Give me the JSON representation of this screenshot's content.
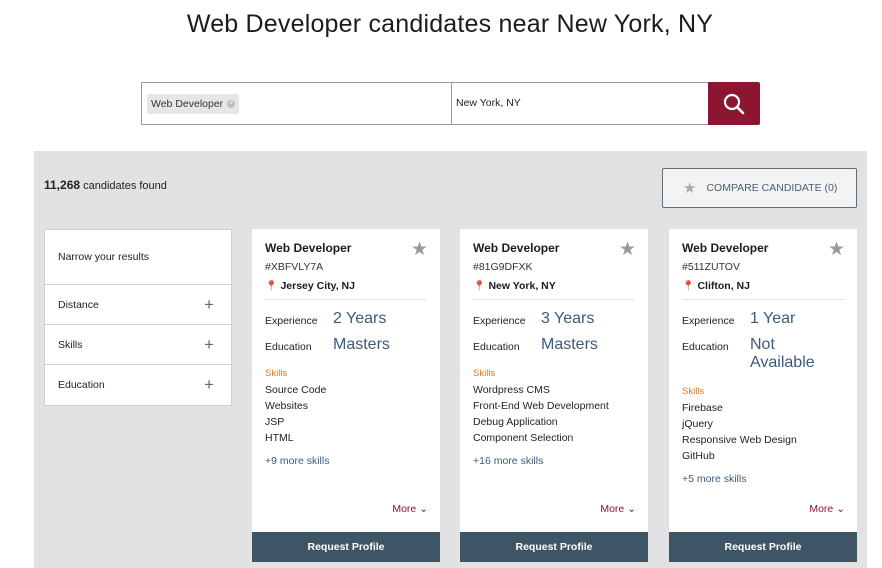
{
  "page": {
    "title": "Web Developer candidates near New York, NY"
  },
  "search": {
    "keyword_chip": "Web Developer",
    "location": "New York, NY"
  },
  "results": {
    "count": "11,268",
    "count_suffix": "candidates found",
    "compare_label": "COMPARE CANDIDATE (0)"
  },
  "filters": {
    "header": "Narrow your results",
    "items": [
      "Distance",
      "Skills",
      "Education"
    ]
  },
  "labels": {
    "experience": "Experience",
    "education": "Education",
    "skills": "Skills",
    "more": "More",
    "request": "Request Profile"
  },
  "cards": [
    {
      "title": "Web Developer",
      "id": "#XBFVLY7A",
      "location": "Jersey City, NJ",
      "experience": "2 Years",
      "education": "Masters",
      "skills": [
        "Source Code",
        "Websites",
        "JSP",
        "HTML"
      ],
      "more_skills": "+9 more skills"
    },
    {
      "title": "Web Developer",
      "id": "#81G9DFXK",
      "location": "New York, NY",
      "experience": "3 Years",
      "education": "Masters",
      "skills": [
        "Wordpress CMS",
        "Front-End Web Development",
        "Debug Application",
        "Component Selection"
      ],
      "more_skills": "+16 more skills"
    },
    {
      "title": "Web Developer",
      "id": "#511ZUTOV",
      "location": "Clifton, NJ",
      "experience": "1 Year",
      "education": "Not Available",
      "skills": [
        "Firebase",
        "jQuery",
        "Responsive Web Design",
        "GitHub"
      ],
      "more_skills": "+5 more skills"
    }
  ],
  "colors": {
    "brand": "#8c1530",
    "accent": "#3e5566",
    "link": "#3d5a78",
    "skills_label": "#d67a1a"
  }
}
